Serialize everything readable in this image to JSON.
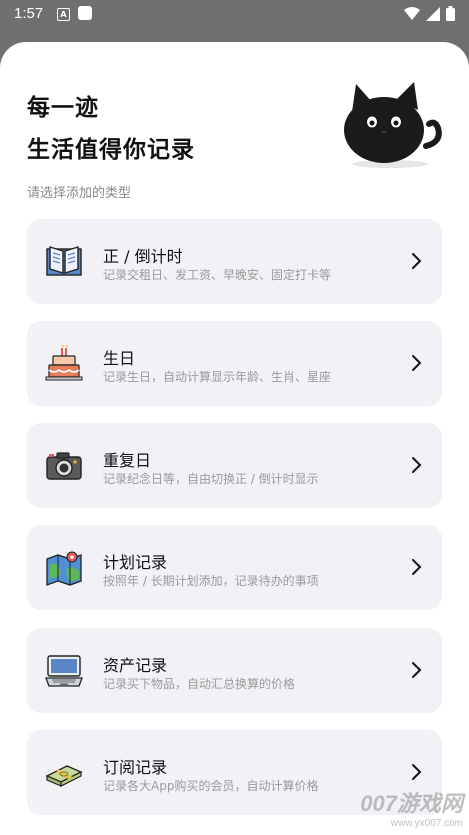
{
  "status_bar": {
    "time": "1:57",
    "a_label": "A"
  },
  "header": {
    "line1": "每一迹",
    "line2": "生活值得你记录"
  },
  "subtitle": "请选择添加的类型",
  "cards": [
    {
      "title": "正 / 倒计时",
      "desc": "记录交租日、发工资、早晚安、固定打卡等",
      "icon": "book-icon"
    },
    {
      "title": "生日",
      "desc": "记录生日，自动计算显示年龄、生肖、星座",
      "icon": "cake-icon"
    },
    {
      "title": "重复日",
      "desc": "记录纪念日等，自由切换正 / 倒计时显示",
      "icon": "camera-icon"
    },
    {
      "title": "计划记录",
      "desc": "按照年 / 长期计划添加，记录待办的事项",
      "icon": "map-icon"
    },
    {
      "title": "资产记录",
      "desc": "记录买下物品，自动汇总换算的价格",
      "icon": "laptop-icon"
    },
    {
      "title": "订阅记录",
      "desc": "记录各大App购买的会员，自动计算价格",
      "icon": "money-icon"
    }
  ],
  "watermark": {
    "main": "007游戏网",
    "sub": "www.yx007.com"
  },
  "colors": {
    "card_bg": "#f1f1f6",
    "backdrop": "#6f6f6f"
  }
}
